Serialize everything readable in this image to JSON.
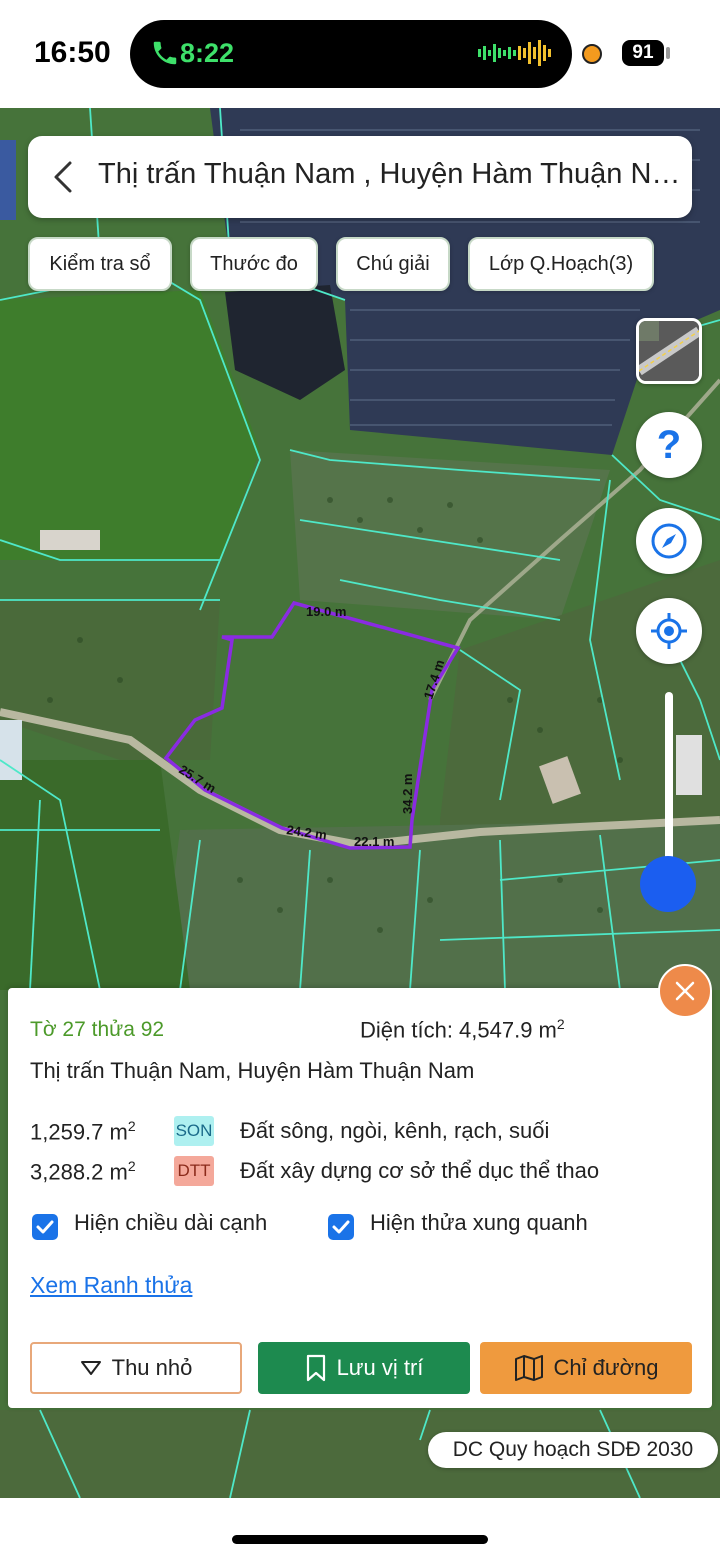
{
  "status_bar": {
    "time": "16:50",
    "call_time": "8:22",
    "battery": "91"
  },
  "search": {
    "title": "Thị trấn Thuận Nam , Huyện Hàm Thuận Nam"
  },
  "chips": [
    {
      "label": "Kiểm tra sổ"
    },
    {
      "label": "Thước đo"
    },
    {
      "label": "Chú giải"
    },
    {
      "label": "Lớp Q.Hoạch(3)"
    }
  ],
  "map": {
    "edge_labels": [
      "19.0 m",
      "17.4 m",
      "25.7 m",
      "24.2 m",
      "22.1 m",
      "34.2 m"
    ],
    "parcel_color": "#8a2be2",
    "boundary_color": "#4ee8c8"
  },
  "controls": {
    "help_symbol": "?"
  },
  "sheet": {
    "parcel_id": "Tờ 27 thửa 92",
    "area_label": "Diện tích: 4,547.9 m",
    "area_sup": "2",
    "address": "Thị trấn Thuận Nam, Huyện Hàm Thuận Nam",
    "land_uses": [
      {
        "area": "1,259.7 m",
        "sup": "2",
        "code": "SON",
        "code_bg": "#aef0f0",
        "code_color": "#1a6a8a",
        "desc": "Đất sông, ngòi, kênh, rạch, suối"
      },
      {
        "area": "3,288.2 m",
        "sup": "2",
        "code": "DTT",
        "code_bg": "#f4a89a",
        "code_color": "#8a2a1a",
        "desc": "Đất xây dựng cơ sở thể dục thể thao"
      }
    ],
    "checkbox_edge_length": "Hiện chiều dài cạnh",
    "checkbox_neighbors": "Hiện thửa xung quanh",
    "view_boundary_link": "Xem Ranh thửa",
    "btn_minimize": "Thu nhỏ",
    "btn_save": "Lưu vị trí",
    "btn_directions": "Chỉ đường"
  },
  "plan_badge": "DC Quy hoạch SDĐ 2030",
  "colors": {
    "accent_blue": "#1a73e8",
    "save_green": "#1d8a4f",
    "directions_orange": "#ef9a3e",
    "close_orange": "#ee8a4a"
  }
}
